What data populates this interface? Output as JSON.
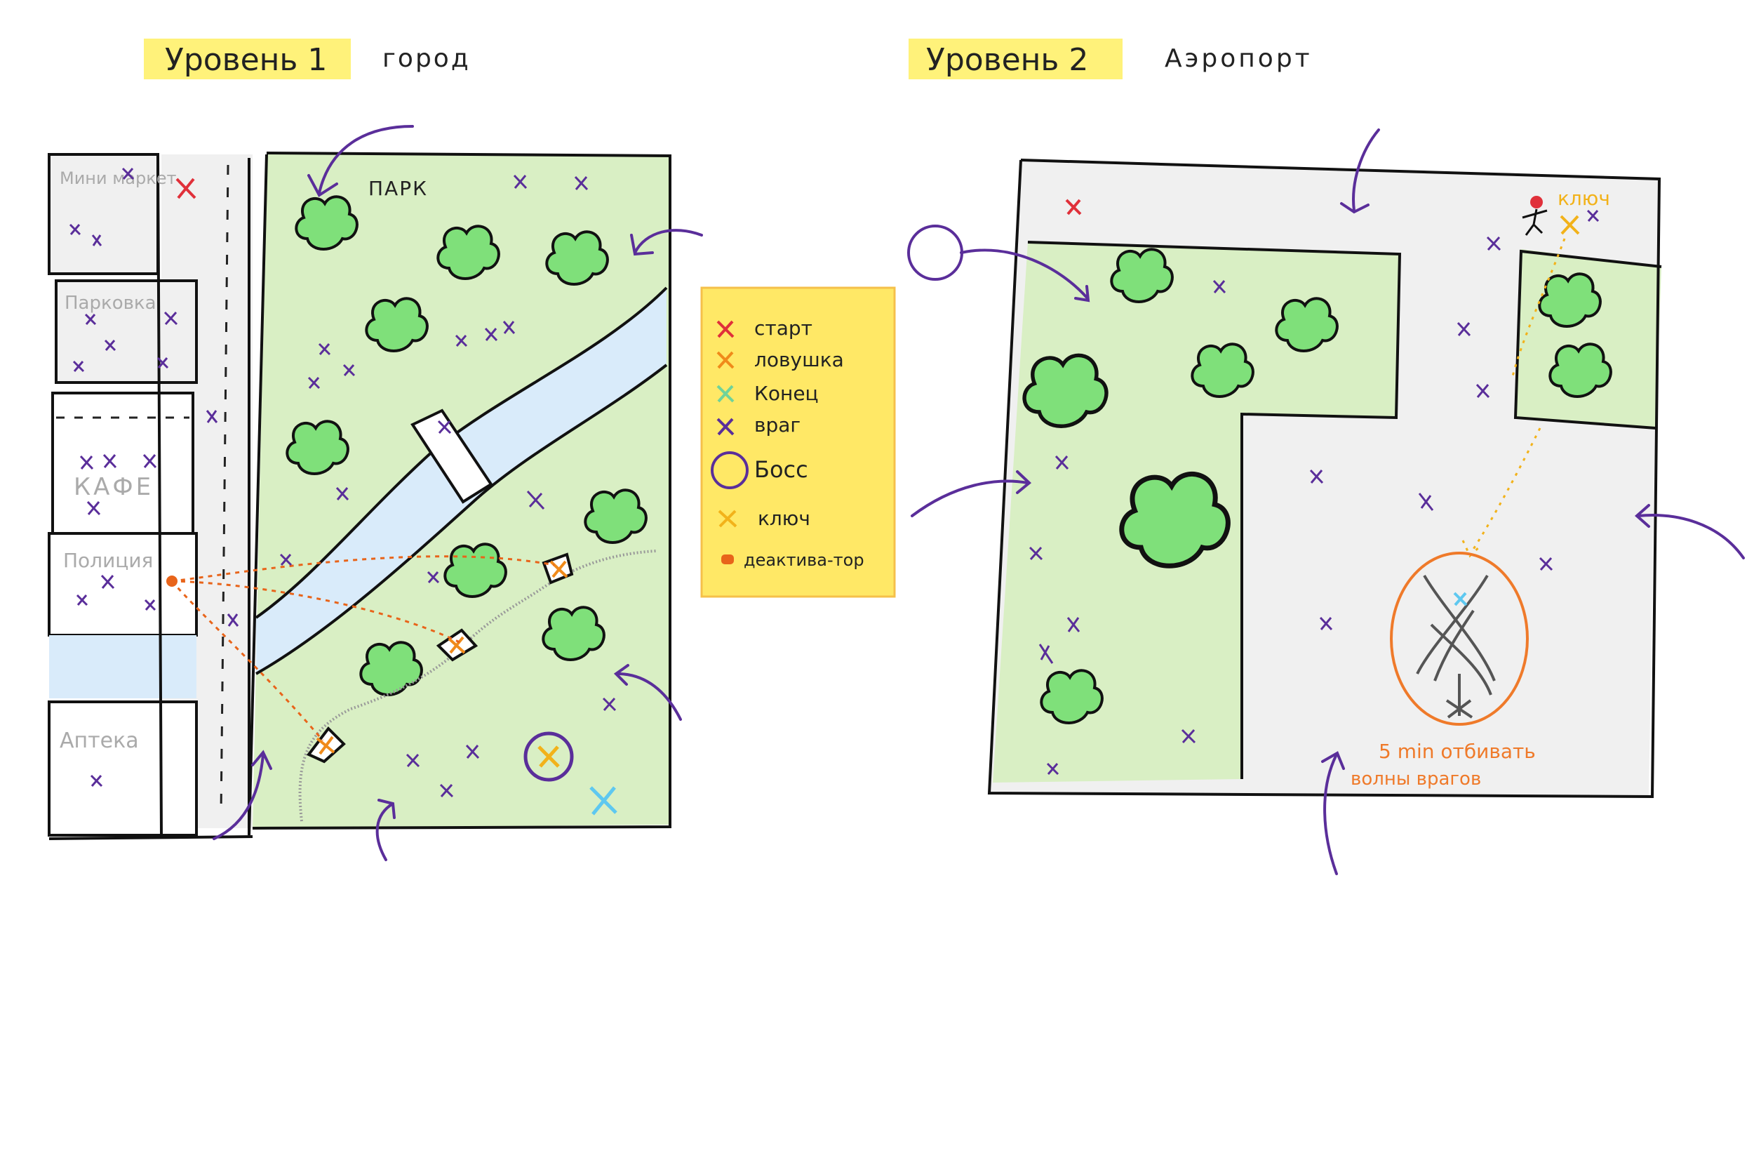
{
  "level1": {
    "badge": "Уровень 1",
    "subtitle": "город",
    "park_label": "ПАРК",
    "buildings": [
      "Мини маркет",
      "Парковка",
      "КАФЕ",
      "Полиция",
      "Аптека"
    ]
  },
  "level2": {
    "badge": "Уровень 2",
    "subtitle": "Аэропорт",
    "key_label": "ключ",
    "boss_note_line1": "5 min отбивать",
    "boss_note_line2": "волны врагов"
  },
  "legend": {
    "items": [
      {
        "label": "старт",
        "color": "#e0303a",
        "marker": "x-icon"
      },
      {
        "label": "ловушка",
        "color": "#f08a1a",
        "marker": "x-icon"
      },
      {
        "label": "Конец",
        "color": "#6fd39a",
        "marker": "x-icon"
      },
      {
        "label": "враг",
        "color": "#5a2e9a",
        "marker": "x-icon"
      },
      {
        "label": "Босс",
        "color": "#5a2e9a",
        "marker": "circle-icon"
      },
      {
        "label": "ключ",
        "color": "#f2b21a",
        "marker": "x-icon"
      },
      {
        "label": "деактива-тор",
        "color": "#e8641a",
        "marker": "dot-icon"
      }
    ]
  },
  "colors": {
    "highlight": "#fff27a",
    "legend_bg": "#ffe866",
    "park_light": "#d9efc4",
    "tree": "#7fe07a",
    "river": "#d9ebfa",
    "road": "#f0f0f0",
    "enemy": "#5a2e9a",
    "trap": "#f08a1a",
    "start": "#e0303a",
    "end": "#5ec8f0",
    "key": "#f2b21a",
    "boss_zone": "#ef7a2a",
    "building_text": "#aaaaaa"
  }
}
